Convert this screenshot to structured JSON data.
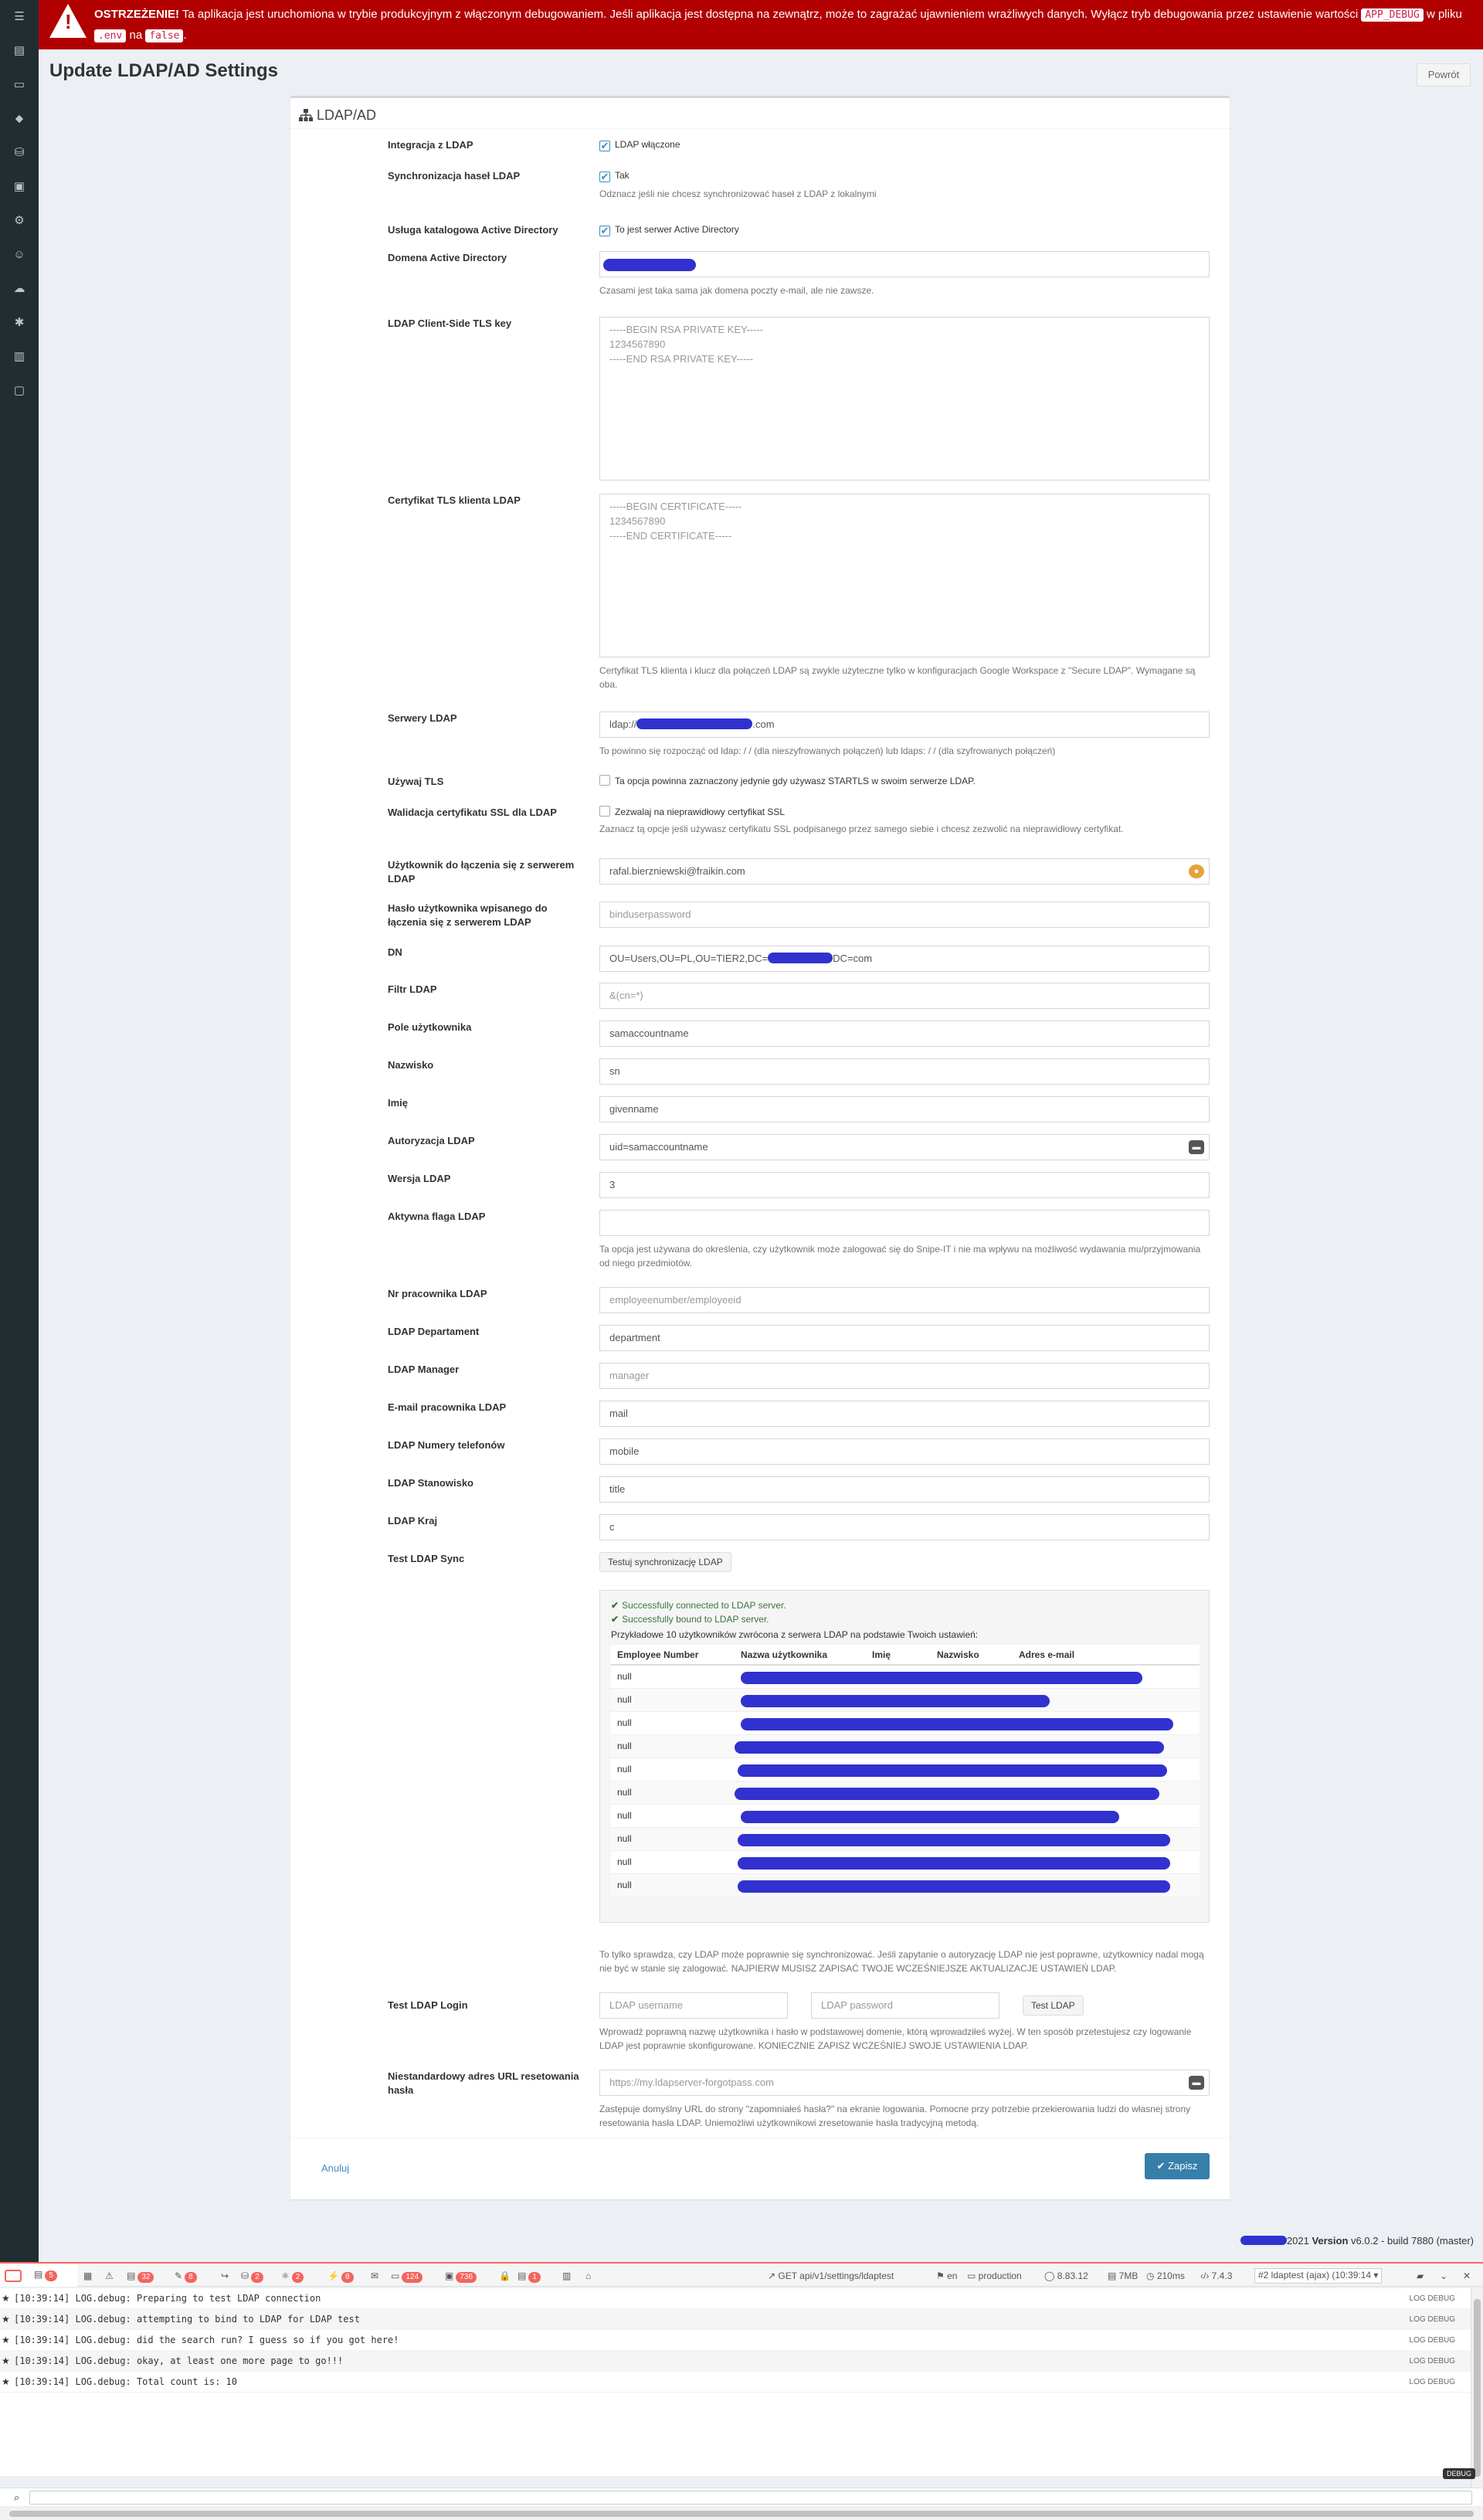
{
  "sidebar": {
    "icons": [
      "dashboard-icon",
      "barcode-icon",
      "license-icon",
      "accessory-icon",
      "consumable-icon",
      "component-icon",
      "kit-icon",
      "users-icon",
      "import-icon",
      "settings-icon",
      "reports-icon",
      "requestable-icon"
    ]
  },
  "alert": {
    "label": "OSTRZEŻENIE!",
    "text1": " Ta aplikacja jest uruchomiona w trybie produkcyjnym z włączonym debugowaniem. Jeśli aplikacja jest dostępna na zewnątrz, może to zagrażać ujawnieniem wrażliwych danych. Wyłącz tryb debugowania przez ustawienie wartości ",
    "code1": "APP_DEBUG",
    "text2": " w pliku ",
    "code2": ".env",
    "text3": " na ",
    "code3": "false",
    "text4": "."
  },
  "page": {
    "title": "Update LDAP/AD Settings",
    "back": "Powrót"
  },
  "box": {
    "title": "LDAP/AD"
  },
  "form": {
    "integration": {
      "label": "Integracja z LDAP",
      "checkbox": "LDAP włączone"
    },
    "pw_sync": {
      "label": "Synchronizacja haseł LDAP",
      "checkbox": "Tak",
      "help": "Odznacz jeśli nie chcesz synchronizować haseł z LDAP z lokalnymi"
    },
    "ad": {
      "label": "Usługa katalogowa Active Directory",
      "checkbox": "To jest serwer Active Directory"
    },
    "ad_domain": {
      "label": "Domena Active Directory",
      "help": "Czasami jest taka sama jak domena poczty e-mail, ale nie zawsze."
    },
    "client_key": {
      "label": "LDAP Client-Side TLS key",
      "placeholder": "-----BEGIN RSA PRIVATE KEY-----\n1234567890\n-----END RSA PRIVATE KEY-----"
    },
    "client_cert": {
      "label": "Certyfikat TLS klienta LDAP",
      "placeholder": "-----BEGIN CERTIFICATE-----\n1234567890\n-----END CERTIFICATE-----",
      "help": "Certyfikat TLS klienta i klucz dla połączeń LDAP są zwykle użyteczne tylko w konfiguracjach Google Workspace z \"Secure LDAP\". Wymagane są oba."
    },
    "servers": {
      "label": "Serwery LDAP",
      "value_start": "ldap://",
      "value_end": ".com",
      "help": "To powinno się rozpocząć od ldap: / / (dla nieszyfrowanych połączeń) lub ldaps: / / (dla szyfrowanych połączeń)"
    },
    "tls": {
      "label": "Używaj TLS",
      "checkbox": "Ta opcja powinna zaznaczony jedynie gdy używasz STARTLS w swoim serwerze LDAP."
    },
    "ssl": {
      "label": "Walidacja certyfikatu SSL dla LDAP",
      "checkbox": "Zezwalaj na nieprawidłowy certyfikat SSL",
      "help": "Zaznacz tą opcje jeśli używasz certyfikatu SSL podpisanego przez samego siebie i chcesz zezwolić na nieprawidłowy certyfikat."
    },
    "bind_user": {
      "label": "Użytkownik do łączenia się z serwerem LDAP",
      "value": "rafal.bierzniewski@fraikin.com"
    },
    "bind_pw": {
      "label": "Hasło użytkownika wpisanego do łączenia się z serwerem LDAP",
      "placeholder": "binduserpassword"
    },
    "dn": {
      "label": "DN",
      "value_start": "OU=Users,OU=PL,OU=TIER2,DC=",
      "value_end": "DC=com"
    },
    "filter": {
      "label": "Filtr LDAP",
      "placeholder": "&(cn=*)"
    },
    "username_field": {
      "label": "Pole użytkownika",
      "value": "samaccountname"
    },
    "lastname": {
      "label": "Nazwisko",
      "value": "sn"
    },
    "firstname": {
      "label": "Imię",
      "value": "givenname"
    },
    "auth": {
      "label": "Autoryzacja LDAP",
      "value": "uid=samaccountname"
    },
    "version": {
      "label": "Wersja LDAP",
      "value": "3"
    },
    "active_flag": {
      "label": "Aktywna flaga LDAP",
      "help": "Ta opcja jest używana do określenia, czy użytkownik może zalogować się do Snipe-IT i nie ma wpływu na możliwość wydawania mu/przyjmowania od niego przedmiotów."
    },
    "emp_num": {
      "label": "Nr pracownika LDAP",
      "placeholder": "employeenumber/employeeid"
    },
    "dept": {
      "label": "LDAP Departament",
      "value": "department"
    },
    "manager": {
      "label": "LDAP Manager",
      "placeholder": "manager"
    },
    "email": {
      "label": "E-mail pracownika LDAP",
      "value": "mail"
    },
    "phone": {
      "label": "LDAP Numery telefonów",
      "value": "mobile"
    },
    "title": {
      "label": "LDAP Stanowisko",
      "value": "title"
    },
    "country": {
      "label": "LDAP Kraj",
      "value": "c"
    },
    "test_sync": {
      "label": "Test LDAP Sync",
      "button": "Testuj synchronizację LDAP"
    },
    "sync_help": "To tylko sprawdza, czy LDAP może poprawnie się synchronizować. Jeśli zapytanie o autoryzację LDAP nie jest poprawne, użytkownicy nadal mogą nie być w stanie się zalogować. NAJPIERW MUSISZ ZAPISAĆ TWOJE WCZEŚNIEJSZE AKTUALIZACJE USTAWIEŃ LDAP.",
    "test_login": {
      "label": "Test LDAP Login",
      "user_ph": "LDAP username",
      "pw_ph": "LDAP password",
      "button": "Test LDAP",
      "help": "Wprowadź poprawną nazwę użytkownika i hasło w podstawowej domenie, którą wprowadziłeś wyżej. W ten sposób przetestujesz czy logowanie LDAP jest poprawnie skonfigurowane. KONIECZNIE ZAPISZ WCZEŚNIEJ SWOJE USTAWIENIA LDAP."
    },
    "reset_url": {
      "label": "Niestandardowy adres URL resetowania hasła",
      "placeholder": "https://my.ldapserver-forgotpass.com",
      "help": "Zastępuje domyślny URL do strony \"zapomniałeś hasła?\" na ekranie logowania. Pomocne przy potrzebie przekierowania ludzi do własnej strony resetowania hasła LDAP. Uniemożliwi użytkownikowi zresetowanie hasła tradycyjną metodą."
    }
  },
  "results": {
    "ok1": "Successfully connected to LDAP server.",
    "ok2": "Successfully bound to LDAP server.",
    "sample": "Przykładowe 10 użytkowników zwrócona z serwera LDAP na podstawie Twoich ustawień:",
    "headers": [
      "Employee Number",
      "Nazwa użytkownika",
      "Imię",
      "Nazwisko",
      "Adres e-mail"
    ],
    "rows": [
      "null",
      "null",
      "null",
      "null",
      "null",
      "null",
      "null",
      "null",
      "null",
      "null"
    ]
  },
  "actions": {
    "cancel": "Anuluj",
    "save": "Zapisz"
  },
  "footer": {
    "year": "2021",
    "version_label": "Version",
    "version": "v6.0.2 - build 7880 (master)"
  },
  "debugbar": {
    "badges": [
      "5",
      "32",
      "8",
      "2",
      "2",
      "8",
      "124",
      "736",
      "1"
    ],
    "request": "GET api/v1/settings/ldaptest",
    "locale": "en",
    "env": "production",
    "laravel": "8.83.12",
    "memory": "7MB",
    "time": "210ms",
    "php": "7.4.3",
    "select": "#2 ldaptest (ajax) (10:39:14"
  },
  "logs": [
    {
      "text": "[10:39:14] LOG.debug: Preparing to test LDAP connection",
      "tag": "LOG  DEBUG"
    },
    {
      "text": "[10:39:14] LOG.debug: attempting to bind to LDAP for LDAP test",
      "tag": "LOG  DEBUG"
    },
    {
      "text": "[10:39:14] LOG.debug: did the search run? I guess so if you got here!",
      "tag": "LOG  DEBUG"
    },
    {
      "text": "[10:39:14] LOG.debug: okay, at least one more page to go!!!",
      "tag": "LOG  DEBUG"
    },
    {
      "text": "[10:39:14] LOG.debug: Total count is: 10",
      "tag": "LOG  DEBUG"
    }
  ],
  "debug_tag": "DEBUG",
  "colors": {
    "alert": "#b20000",
    "primary": "#367fa9",
    "sidebar": "#222d32",
    "redaction": "#3131cf"
  }
}
